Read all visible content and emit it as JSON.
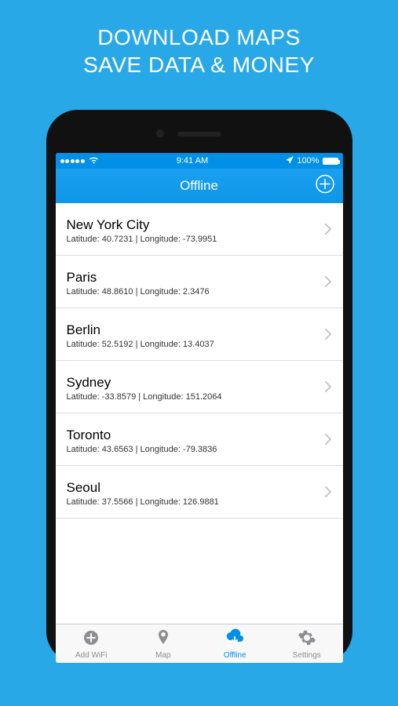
{
  "promo": {
    "line1": "DOWNLOAD MAPS",
    "line2": "SAVE DATA & MONEY"
  },
  "statusbar": {
    "time": "9:41 AM",
    "battery": "100%"
  },
  "navbar": {
    "title": "Offline"
  },
  "locations": [
    {
      "name": "New York City",
      "sub": "Latitude: 40.7231 | Longitude: -73.9951"
    },
    {
      "name": "Paris",
      "sub": "Latitude: 48.8610 | Longitude: 2.3476"
    },
    {
      "name": "Berlin",
      "sub": "Latitude: 52.5192 | Longitude: 13.4037"
    },
    {
      "name": "Sydney",
      "sub": "Latitude: -33.8579 | Longitude: 151.2064"
    },
    {
      "name": "Toronto",
      "sub": "Latitude: 43.6563 | Longitude: -79.3836"
    },
    {
      "name": "Seoul",
      "sub": "Latitude: 37.5566 | Longitude: 126.9881"
    }
  ],
  "tabs": [
    {
      "id": "addwifi",
      "label": "Add WiFi",
      "active": false
    },
    {
      "id": "map",
      "label": "Map",
      "active": false
    },
    {
      "id": "offline",
      "label": "Offline",
      "active": true
    },
    {
      "id": "settings",
      "label": "Settings",
      "active": false
    }
  ]
}
